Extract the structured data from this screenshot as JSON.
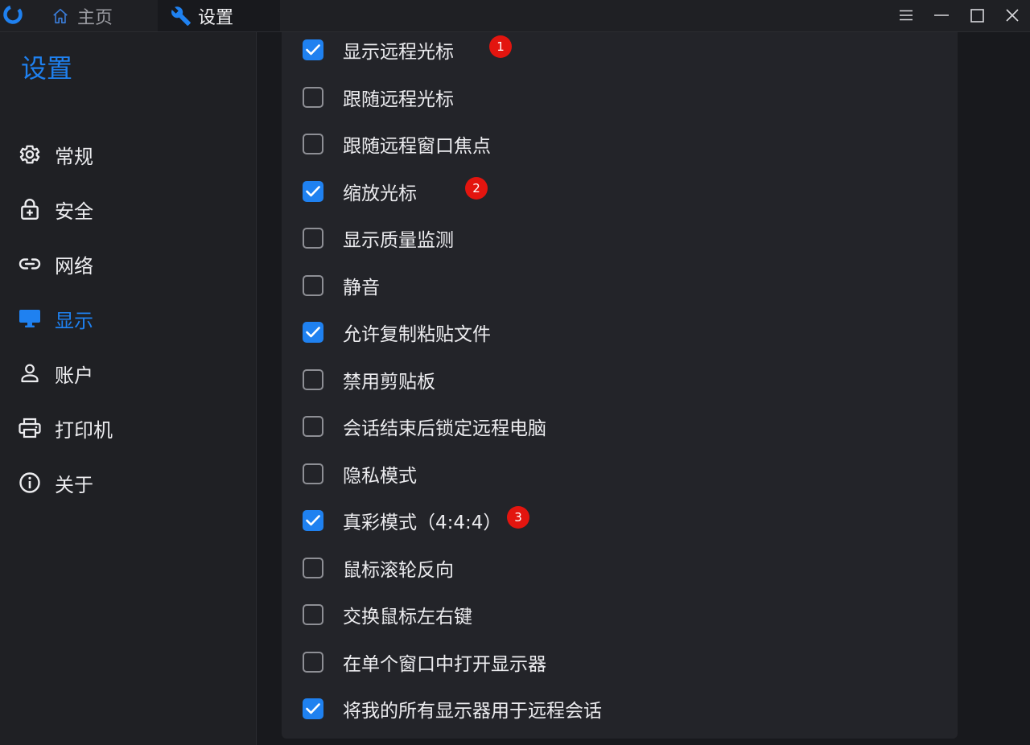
{
  "titlebar": {
    "tabs": [
      {
        "label": "主页",
        "icon": "home-icon"
      },
      {
        "label": "设置",
        "icon": "wrench-icon"
      }
    ],
    "controls": [
      "menu-icon",
      "minimize-icon",
      "maximize-icon",
      "close-icon"
    ]
  },
  "sidebar": {
    "title": "设置",
    "items": [
      {
        "label": "常规",
        "icon": "gear-icon"
      },
      {
        "label": "安全",
        "icon": "lock-icon"
      },
      {
        "label": "网络",
        "icon": "link-icon"
      },
      {
        "label": "显示",
        "icon": "monitor-icon",
        "active": true
      },
      {
        "label": "账户",
        "icon": "person-icon"
      },
      {
        "label": "打印机",
        "icon": "printer-icon"
      },
      {
        "label": "关于",
        "icon": "info-icon"
      }
    ]
  },
  "options": [
    {
      "label": "显示远程光标",
      "checked": true,
      "badge": "1"
    },
    {
      "label": "跟随远程光标",
      "checked": false
    },
    {
      "label": "跟随远程窗口焦点",
      "checked": false
    },
    {
      "label": "缩放光标",
      "checked": true,
      "badge": "2"
    },
    {
      "label": "显示质量监测",
      "checked": false
    },
    {
      "label": "静音",
      "checked": false
    },
    {
      "label": "允许复制粘贴文件",
      "checked": true
    },
    {
      "label": "禁用剪贴板",
      "checked": false
    },
    {
      "label": "会话结束后锁定远程电脑",
      "checked": false
    },
    {
      "label": "隐私模式",
      "checked": false
    },
    {
      "label": "真彩模式（4:4:4）",
      "checked": true,
      "badge": "3"
    },
    {
      "label": "鼠标滚轮反向",
      "checked": false
    },
    {
      "label": "交换鼠标左右键",
      "checked": false
    },
    {
      "label": "在单个窗口中打开显示器",
      "checked": false
    },
    {
      "label": "将我的所有显示器用于远程会话",
      "checked": true
    }
  ],
  "colors": {
    "accent": "#1f81f0",
    "badge": "#e3150f",
    "background": "#18191d",
    "panel": "#232429"
  }
}
